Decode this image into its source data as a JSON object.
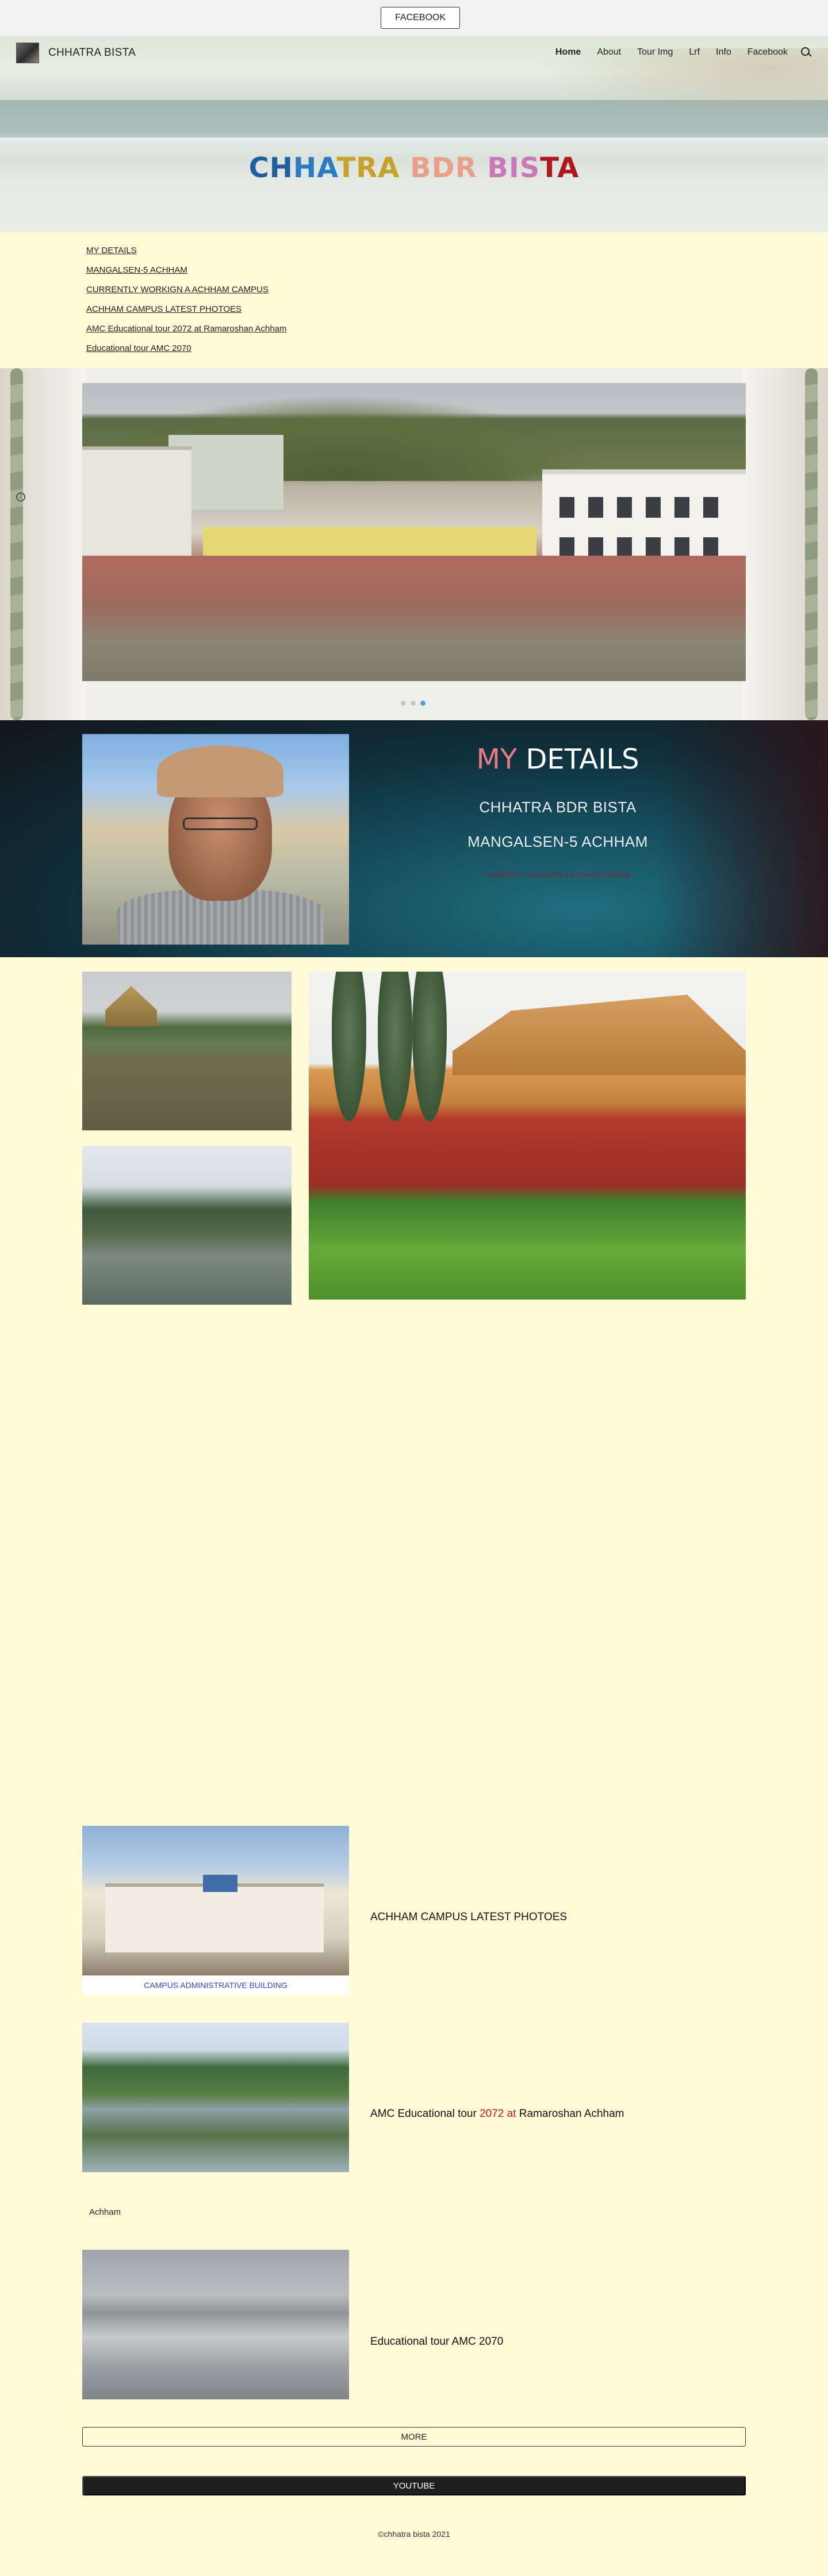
{
  "topbar": {
    "facebook_button": "FACEBOOK"
  },
  "header": {
    "site_name": "CHHATRA BISTA",
    "nav": [
      "Home",
      "About",
      "Tour Img",
      "Lrf",
      "Info",
      "Facebook"
    ],
    "active_nav": "Home",
    "hero_title_parts": [
      {
        "text": "CH",
        "color": "#1f5fa0"
      },
      {
        "text": "HA",
        "color": "#2a7bc4"
      },
      {
        "text": "TRA",
        "color": "#c7a22a"
      },
      {
        "text": " BDR",
        "color": "#e9a08a"
      },
      {
        "text": " BIS",
        "color": "#c978b8"
      },
      {
        "text": "TA",
        "color": "#b0161c"
      }
    ]
  },
  "links": [
    "MY DETAILS",
    "MANGALSEN-5 ACHHAM",
    "CURRENTLY WORKIGN A ACHHAM CAMPUS",
    "ACHHAM CAMPUS LATEST PHOTOES",
    "AMC Educational tour 2072 at Ramaroshan Achham",
    "Educational tour AMC 2070"
  ],
  "carousel": {
    "dots": 3,
    "active_dot": 3,
    "info_icon": "i"
  },
  "details": {
    "title_my": "MY",
    "title_rest": " DETAILS",
    "name": "CHHATRA BDR BISTA",
    "address": "MANGALSEN-5 ACHHAM",
    "small_text": "CURRENTLY WORKIGN A ACHHAM CAMPUS"
  },
  "cards": [
    {
      "title": "ACHHAM CAMPUS LATEST PHOTOES",
      "caption": "CAMPUS ADMINISTRATIVE BUILDING"
    },
    {
      "title_pre": "AMC Educational tour ",
      "title_red": "2072 at",
      "title_post": " Ramaroshan Achham"
    },
    {
      "title": "Educational tour AMC 2070"
    }
  ],
  "achham_label": "Achham",
  "buttons": {
    "more": "MORE",
    "youtube": "YOUTUBE"
  },
  "footer": "©chhatra bista 2021",
  "colors": {
    "page_bg": "#fffbd6",
    "topbar_bg": "#f1f1f1",
    "details_accent": "#e87b86",
    "youtube_bg": "#1f1f1f"
  }
}
